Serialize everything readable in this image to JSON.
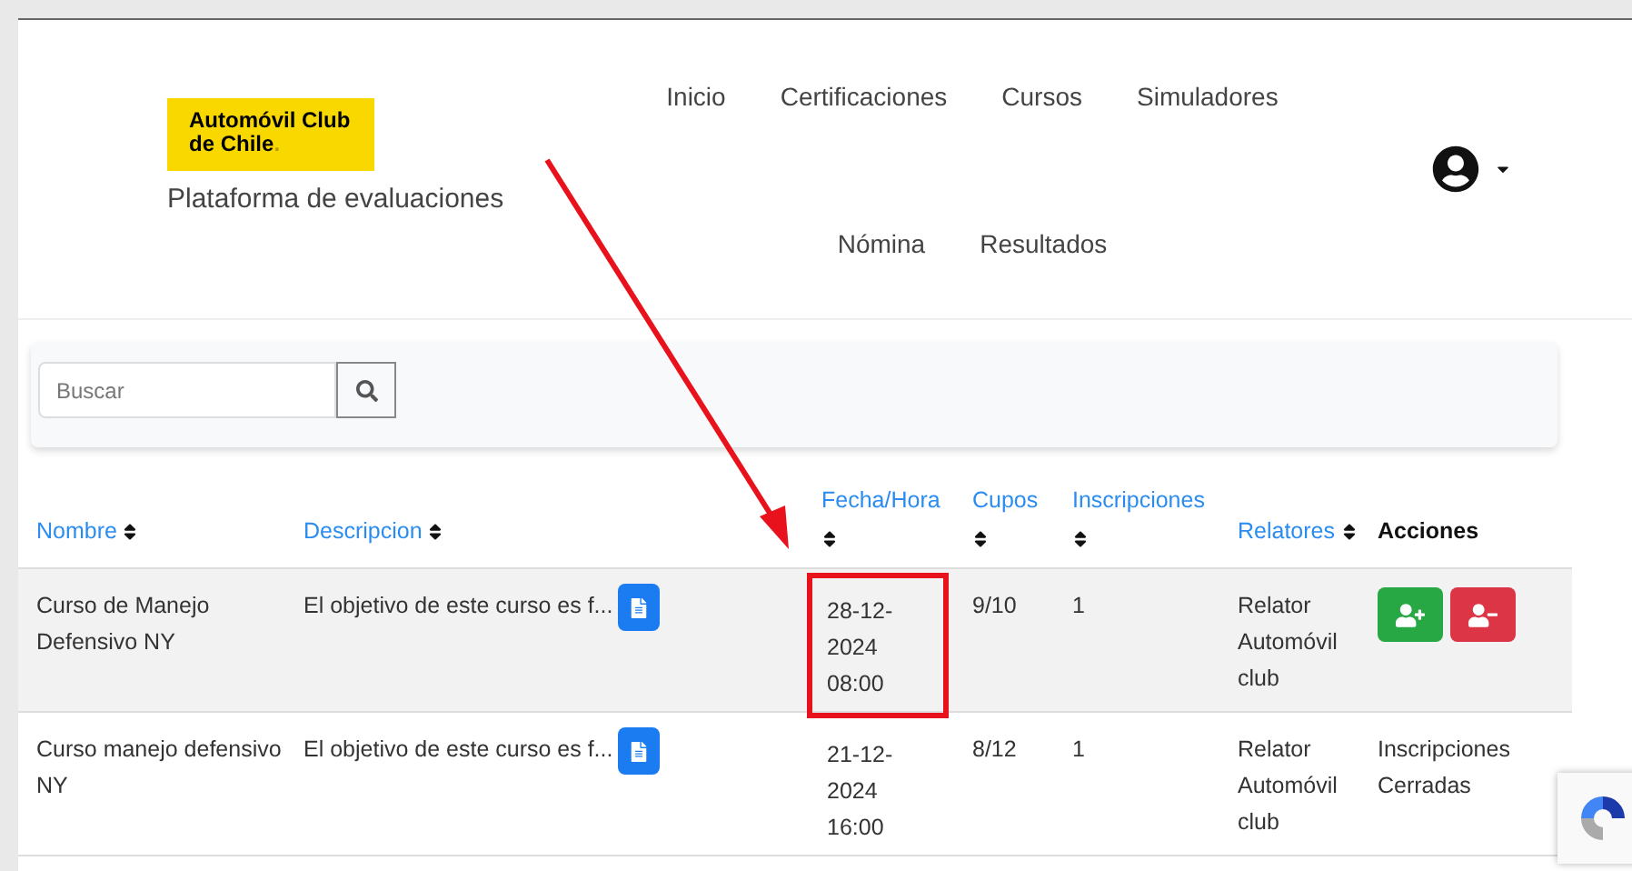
{
  "logo": {
    "line_1": "Automóvil Club",
    "line_2": "de Chile",
    "dot": "."
  },
  "subtitle": "Plataforma de evaluaciones",
  "nav": {
    "row_1": [
      "Inicio",
      "Certificaciones",
      "Cursos",
      "Simuladores"
    ],
    "row_2": [
      "Nómina",
      "Resultados"
    ]
  },
  "search": {
    "placeholder": "Buscar"
  },
  "table": {
    "columns": [
      {
        "label": "Nombre",
        "sortable": true
      },
      {
        "label": "Descripcion",
        "sortable": true
      },
      {
        "label": "Fecha/Hora",
        "sortable": true
      },
      {
        "label": "Cupos",
        "sortable": true
      },
      {
        "label": "Inscripciones",
        "sortable": true
      },
      {
        "label": "Relatores",
        "sortable": true
      },
      {
        "label": "Acciones",
        "sortable": false
      }
    ],
    "rows": [
      {
        "nombre": "Curso de Manejo Defensivo NY",
        "descripcion": "El objetivo de este curso es f...",
        "fecha": "28-12-2024 08:00",
        "fecha_highlighted": true,
        "cupos": "9/10",
        "inscripciones": "1",
        "relatores": "Relator Automóvil club",
        "acciones": {
          "kind": "buttons"
        }
      },
      {
        "nombre": "Curso manejo defensivo NY",
        "descripcion": "El objetivo de este curso es f...",
        "fecha": "21-12-2024 16:00",
        "fecha_highlighted": false,
        "cupos": "8/12",
        "inscripciones": "1",
        "relatores": "Relator Automóvil club",
        "acciones": {
          "kind": "text",
          "text": "Inscripciones Cerradas"
        }
      }
    ]
  }
}
